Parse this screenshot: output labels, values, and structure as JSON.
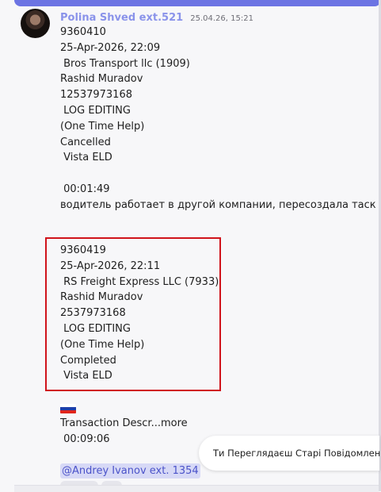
{
  "message": {
    "sender": "Polina Shved ext.521",
    "timestamp": "25.04.26, 15:21",
    "lines": [
      "9360410",
      "25-Apr-2026, 22:09",
      " Bros Transport llc (1909)",
      "Rashid Muradov",
      "12537973168",
      " LOG EDITING",
      "(One Time Help)",
      "Cancelled",
      " Vista ELD",
      "",
      " 00:01:49",
      "водитель работает в другой компании, пересоздала таск"
    ]
  },
  "message2": {
    "lines": [
      "9360419",
      "25-Apr-2026, 22:11",
      " RS Freight Express LLC (7933)",
      "Rashid Muradov",
      "2537973168",
      " LOG EDITING",
      "(One Time Help)",
      "Completed",
      " Vista ELD"
    ],
    "flag_icon": "russia-flag-icon",
    "flag_colors": [
      "#ffffff",
      "#1c3faa",
      "#e1251b"
    ],
    "description": "Transaction Descr...",
    "more_label": "more",
    "duration": " 00:09:06",
    "mention": "@Andrey Ivanov ext. 1354"
  },
  "toast": {
    "text": "Ти Переглядаєш Старі Повідомлення"
  },
  "colors": {
    "accent": "#6c74e3",
    "sender": "#8a93ea",
    "highlight": "#d0131b",
    "mention_bg": "#d7d9f6"
  }
}
